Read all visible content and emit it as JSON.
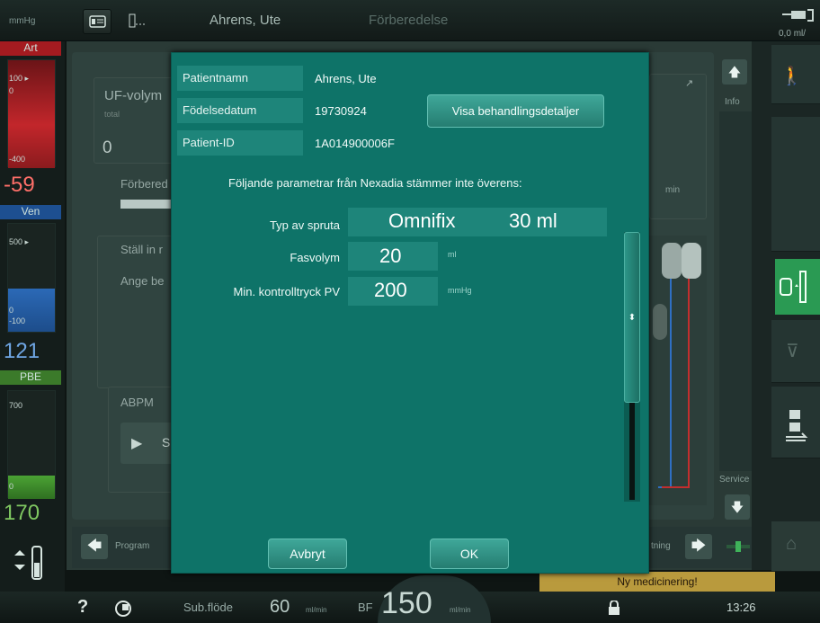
{
  "topbar": {
    "pressure_unit": "mmHg",
    "patient_name": "Ahrens, Ute",
    "phase": "Förberedelse",
    "right_value": "0,0",
    "right_unit": "ml/"
  },
  "left": {
    "art": {
      "label": "Art",
      "scale_top": "100",
      "scale_zero": "0",
      "scale_bottom": "-400",
      "value": "-59"
    },
    "ven": {
      "label": "Ven",
      "scale_top": "500",
      "scale_zero": "0",
      "scale_bottom": "-100",
      "value": "121"
    },
    "pbe": {
      "label": "PBE",
      "scale_top": "700",
      "scale_zero": "0",
      "value": "170"
    }
  },
  "background": {
    "uf_label": "UF-volym",
    "uf_sub": "total",
    "uf_value": "0",
    "prep_label": "Förbered",
    "set_label": "Ställ in r",
    "enter_label": "Ange be",
    "abpm_label": "ABPM",
    "abpm_btn": "S",
    "min_label": "min",
    "program_label": "Program",
    "rinse_label": "tning",
    "info_label": "Info",
    "service_label": "Service"
  },
  "dialog": {
    "rows": [
      {
        "label": "Patientnamn",
        "value": "Ahrens, Ute"
      },
      {
        "label": "Födelsedatum",
        "value": "19730924"
      },
      {
        "label": "Patient-ID",
        "value": "1A014900006F"
      }
    ],
    "details_button": "Visa behandlingsdetaljer",
    "warning": "Följande parametrar från Nexadia stämmer inte överens:",
    "params": {
      "syringe": {
        "label": "Typ av spruta",
        "value_a": "Omnifix",
        "value_b": "30 ml"
      },
      "bolus": {
        "label": "Fasvolym",
        "value": "20",
        "unit": "ml"
      },
      "minpv": {
        "label": "Min. kontrolltryck PV",
        "value": "200",
        "unit": "mmHg"
      }
    },
    "cancel": "Avbryt",
    "ok": "OK"
  },
  "notice": "Ny medicinering!",
  "bottombar": {
    "help": "?",
    "sub_flow_label": "Sub.flöde",
    "sub_flow_value": "60",
    "sub_flow_unit": "ml/min",
    "bf_label": "BF",
    "bf_value": "150",
    "bf_unit": "ml/min",
    "time": "13:26"
  },
  "colors": {
    "dialog_bg": "#0e7368",
    "field_bg": "#1e857a",
    "alarm_red": "#ff6f69",
    "notice_amber": "#b99a3d"
  }
}
